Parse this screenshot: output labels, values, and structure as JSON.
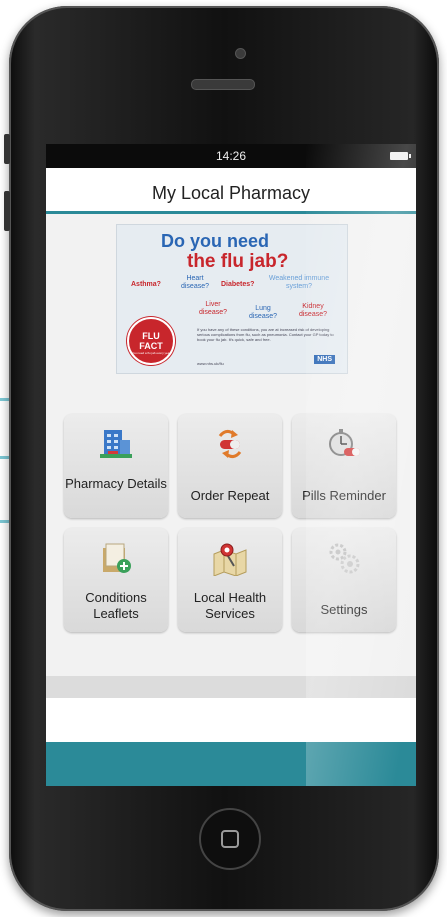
{
  "status": {
    "time": "14:26"
  },
  "app": {
    "title": "My Local Pharmacy"
  },
  "banner": {
    "line1": "Do you need",
    "line2": "the flu jab?",
    "conditions": [
      "Asthma?",
      "Heart disease?",
      "Diabetes?",
      "Weakened immune system?",
      "Liver disease?",
      "Lung disease?",
      "Kidney disease?"
    ],
    "badge_line1": "FLU",
    "badge_line2": "FACT",
    "badge_sub": "You need a flu jab every year",
    "body": "If you have any of these conditions, you are at increased risk of developing serious complications from flu, such as pneumonia. Contact your GP today to book your flu jab. It's quick, safe and free.",
    "footer": "www.nhs.uk/flu",
    "logo": "NHS"
  },
  "tiles": [
    {
      "label": "Pharmacy Details",
      "icon": "building-icon"
    },
    {
      "label": "Order Repeat",
      "icon": "pill-arrows-icon"
    },
    {
      "label": "Pills Reminder",
      "icon": "stopwatch-pill-icon"
    },
    {
      "label": "Conditions Leaflets",
      "icon": "leaflet-folder-icon"
    },
    {
      "label": "Local Health Services",
      "icon": "map-pin-icon"
    },
    {
      "label": "Settings",
      "icon": "gears-icon"
    }
  ],
  "colors": {
    "accent": "#2b8a98",
    "nhs_blue": "#2a66b4",
    "flu_red": "#c8262c"
  }
}
